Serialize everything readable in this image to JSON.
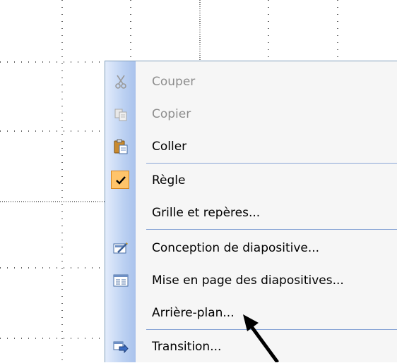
{
  "menu": {
    "items": [
      {
        "label": "Couper",
        "icon": "scissors-icon",
        "disabled": true
      },
      {
        "label": "Copier",
        "icon": "copy-icon",
        "disabled": true
      },
      {
        "label": "Coller",
        "icon": "paste-icon",
        "disabled": false
      },
      {
        "label": "Règle",
        "icon": "check-icon",
        "disabled": false,
        "checked": true
      },
      {
        "label": "Grille et repères...",
        "icon": "",
        "disabled": false
      },
      {
        "label": "Conception de diapositive...",
        "icon": "slide-design-icon",
        "disabled": false
      },
      {
        "label": "Mise en page des diapositives...",
        "icon": "slide-layout-icon",
        "disabled": false
      },
      {
        "label": "Arrière-plan...",
        "icon": "",
        "disabled": false
      },
      {
        "label": "Transition...",
        "icon": "transition-icon",
        "disabled": false
      }
    ]
  },
  "colors": {
    "menu_background": "#f6f6f6",
    "gutter_start": "#e3ecfb",
    "gutter_end": "#a9c2ec",
    "separator": "#8aa6d6",
    "disabled_text": "#8d8d8d",
    "check_highlight": "#ffc46a"
  }
}
